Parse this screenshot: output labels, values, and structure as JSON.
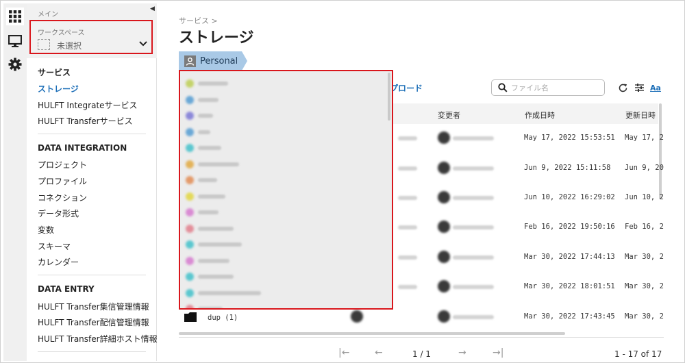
{
  "sidebar": {
    "main_label": "メイン",
    "workspace": {
      "label": "ワークスペース",
      "value": "未選択"
    },
    "sections": [
      {
        "title": "サービス",
        "items": [
          "ストレージ",
          "HULFT Integrateサービス",
          "HULFT Transferサービス"
        ]
      },
      {
        "title": "DATA INTEGRATION",
        "items": [
          "プロジェクト",
          "プロファイル",
          "コネクション",
          "データ形式",
          "変数",
          "スキーマ",
          "カレンダー"
        ]
      },
      {
        "title": "DATA ENTRY",
        "items": [
          "HULFT Transfer集信管理情報",
          "HULFT Transfer配信管理情報",
          "HULFT Transfer詳細ホスト情報"
        ]
      }
    ],
    "active_item": "ストレージ"
  },
  "header": {
    "breadcrumb": "サービス >",
    "title": "ストレージ",
    "tab": "Personal"
  },
  "toolbar": {
    "upload_label": "プロード",
    "search_placeholder": "ファイル名",
    "aa_label": "Aa"
  },
  "table": {
    "columns": [
      "変更者",
      "作成日時",
      "更新日時"
    ],
    "rows": [
      {
        "created": "May 17, 2022 15:53:51",
        "updated": "May 17, 2"
      },
      {
        "created": "Jun 9, 2022 15:11:58",
        "updated": "Jun 9, 20"
      },
      {
        "created": "Jun 10, 2022 16:29:02",
        "updated": "Jun 10, 2"
      },
      {
        "created": "Feb 16, 2022 19:50:16",
        "updated": "Feb 16, 2"
      },
      {
        "created": "Mar 30, 2022 17:44:13",
        "updated": "Mar 30, 2"
      },
      {
        "created": "Mar 30, 2022 18:01:51",
        "updated": "Mar 30, 2"
      },
      {
        "name": "dup (1)",
        "created": "Mar 30, 2022 17:43:45",
        "updated": "Mar 30, 2"
      }
    ]
  },
  "dropdown": {
    "dot_colors": [
      "#c4d36a",
      "#6aa8d6",
      "#8c89d9",
      "#6aa8d6",
      "#5bc7cf",
      "#e3b35a",
      "#e39a6a",
      "#e3d95a",
      "#d98bd3",
      "#e38f9a",
      "#5bc7cf",
      "#d98bd3",
      "#5bc7cf",
      "#5bc7cf",
      "#e38f9a"
    ]
  },
  "pagination": {
    "first": "|←",
    "prev": "←",
    "page": "1 / 1",
    "next": "→",
    "last": "→|",
    "count": "1 - 17 of 17"
  }
}
